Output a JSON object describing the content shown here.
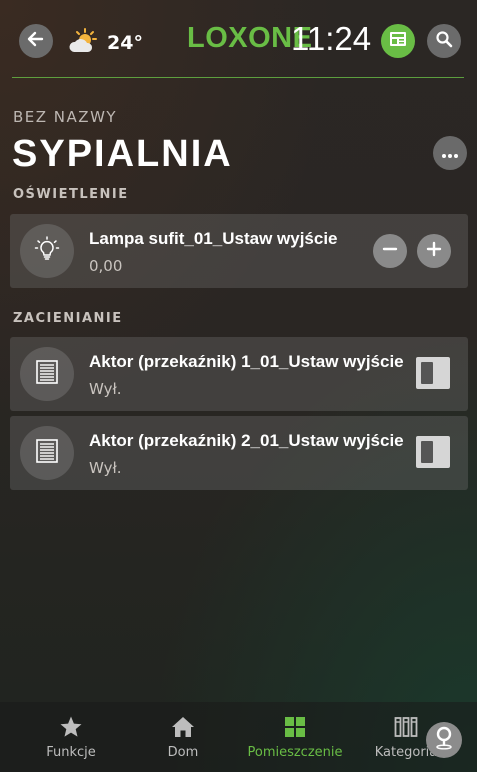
{
  "topbar": {
    "back_icon": "arrow-left-icon",
    "weather_icon": "partly-sunny-icon",
    "temperature": "24°",
    "brand": "LOXONE",
    "time": "11:24",
    "news_icon": "newspaper-icon",
    "search_icon": "search-icon",
    "accent_color": "#69bd45"
  },
  "room": {
    "subtitle": "BEZ NAZWY",
    "title": "SYPIALNIA",
    "more_icon": "more-dots-icon"
  },
  "sections": [
    {
      "title": "OŚWIETLENIE",
      "controls": [
        {
          "icon": "light-bulb-icon",
          "name": "Lampa sufit_01_Ustaw wyjście",
          "value": "0,00",
          "minus_icon": "minus-icon",
          "plus_icon": "plus-icon"
        }
      ]
    },
    {
      "title": "ZACIENIANIE",
      "controls": [
        {
          "icon": "blinds-icon",
          "name": "Aktor (przekaźnik) 1_01_Ustaw wyjście",
          "value": "Wył.",
          "toggle_state": "off"
        },
        {
          "icon": "blinds-icon",
          "name": "Aktor (przekaźnik) 2_01_Ustaw wyjście",
          "value": "Wył.",
          "toggle_state": "off"
        }
      ]
    }
  ],
  "bottom_nav": {
    "items": [
      {
        "label": "Funkcje",
        "icon": "star-icon",
        "active": false
      },
      {
        "label": "Dom",
        "icon": "home-icon",
        "active": false
      },
      {
        "label": "Pomieszczenie",
        "icon": "grid-icon",
        "active": true
      },
      {
        "label": "Kategoria",
        "icon": "category-icon",
        "active": false
      }
    ],
    "map_pin_icon": "map-pin-icon"
  }
}
